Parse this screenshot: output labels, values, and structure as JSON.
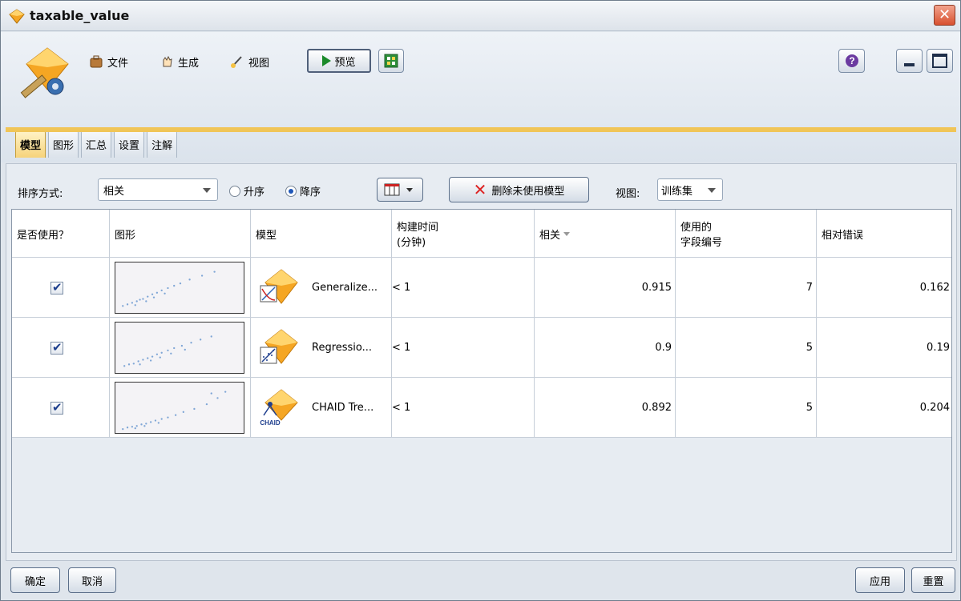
{
  "window": {
    "title": "taxable_value",
    "close_glyph": "✕"
  },
  "toolbar": {
    "file_label": "文件",
    "generate_label": "生成",
    "view_label": "视图",
    "preview_label": "预览"
  },
  "tabs": [
    {
      "label": "模型",
      "active": true
    },
    {
      "label": "图形",
      "active": false
    },
    {
      "label": "汇总",
      "active": false
    },
    {
      "label": "设置",
      "active": false
    },
    {
      "label": "注解",
      "active": false
    }
  ],
  "sortbar": {
    "sort_label": "排序方式:",
    "sort_value": "相关",
    "asc_label": "升序",
    "desc_label": "降序",
    "order_selected": "desc",
    "delete_label": "删除未使用模型",
    "view_label": "视图:",
    "view_value": "训练集"
  },
  "table": {
    "headers": {
      "use": "是否使用？",
      "graph": "图形",
      "model": "模型",
      "build_time": "构建时间\n(分钟)",
      "correlation": "相关",
      "fields": "使用的\n字段编号",
      "rel_error": "相对错误"
    },
    "rows": [
      {
        "use": true,
        "model": "Generalize...",
        "build_time": "< 1",
        "correlation": "0.915",
        "fields": "7",
        "rel_error": "0.162",
        "icon": "generalized-linear-icon"
      },
      {
        "use": true,
        "model": "Regressio...",
        "build_time": "< 1",
        "correlation": "0.9",
        "fields": "5",
        "rel_error": "0.19",
        "icon": "regression-icon"
      },
      {
        "use": true,
        "model": "CHAID Tre...",
        "build_time": "< 1",
        "correlation": "0.892",
        "fields": "5",
        "rel_error": "0.204",
        "icon": "chaid-tree-icon",
        "icon_text": "CHAID"
      }
    ]
  },
  "buttons": {
    "ok": "确定",
    "cancel": "取消",
    "apply": "应用",
    "reset": "重置"
  },
  "colors": {
    "tab_active": "#f6d37a",
    "accent_orange": "#f5a623",
    "close_red": "#d8502f"
  }
}
